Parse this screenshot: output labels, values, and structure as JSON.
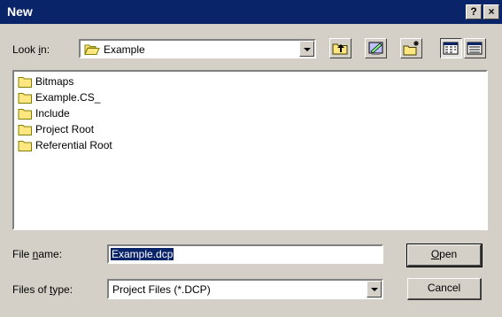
{
  "window": {
    "title": "New",
    "help_label": "?",
    "close_label": "×"
  },
  "lookin": {
    "label_pre": "Look ",
    "label_key": "i",
    "label_post": "n:",
    "value": "Example"
  },
  "toolbar": [
    {
      "name": "up-one-level-icon"
    },
    {
      "name": "desktop-icon"
    },
    {
      "name": "new-folder-icon"
    },
    {
      "name": "list-view-icon",
      "pressed": true
    },
    {
      "name": "details-view-icon"
    }
  ],
  "items": [
    {
      "label": "Bitmaps"
    },
    {
      "label": "Example.CS_"
    },
    {
      "label": "Include"
    },
    {
      "label": "Project Root"
    },
    {
      "label": "Referential Root"
    }
  ],
  "filename": {
    "label_pre": "File ",
    "label_key": "n",
    "label_post": "ame:",
    "value": "Example.dcp"
  },
  "filetype": {
    "label_pre": "Files of ",
    "label_key": "t",
    "label_post": "ype:",
    "value": "Project Files (*.DCP)"
  },
  "buttons": {
    "open_key": "O",
    "open_rest": "pen",
    "cancel": "Cancel"
  },
  "colors": {
    "titlebar": "#0a246a",
    "face": "#d4d0c8",
    "folder": "#ffe680",
    "selection": "#0a246a"
  }
}
